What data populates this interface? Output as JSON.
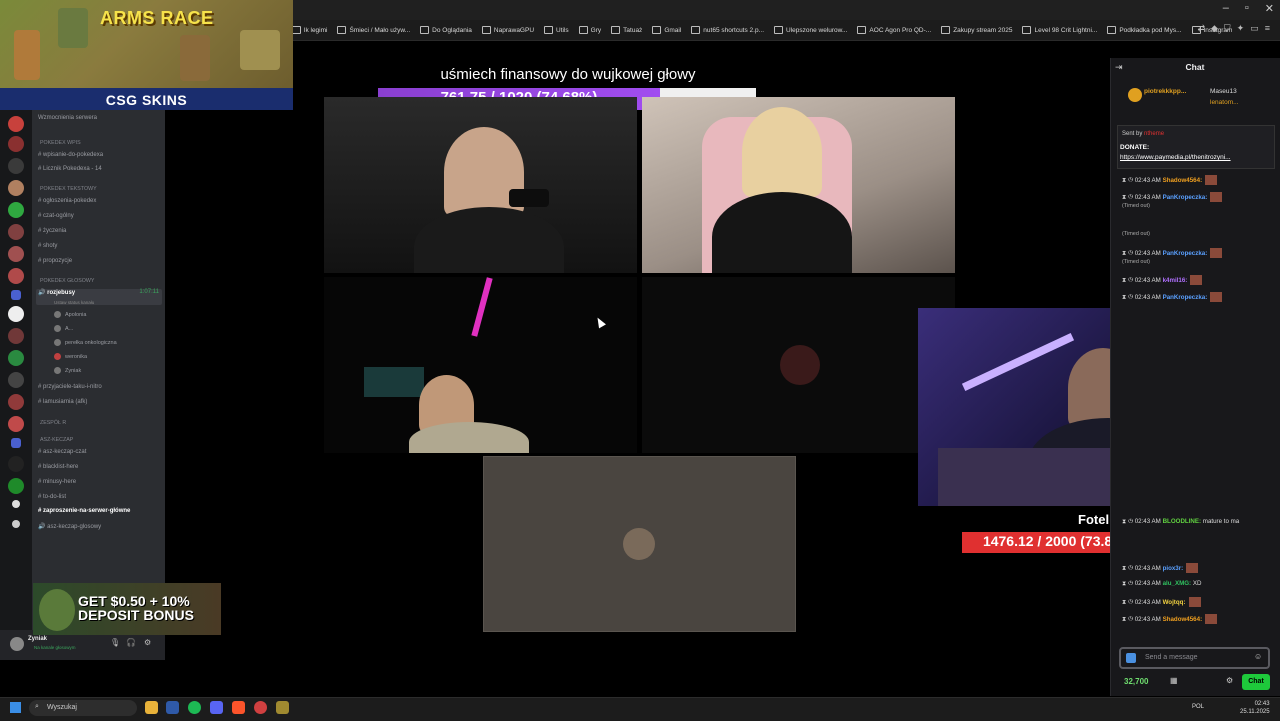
{
  "window": {
    "controls": [
      "–",
      "▫",
      "✕"
    ],
    "bookmarks": [
      "lk legimi",
      "Śmieci / Mało używ...",
      "Do Oglądania",
      "NaprawaGPU",
      "Utils",
      "Gry",
      "Tatuaż",
      "Gmail",
      "nut65 shortcuts 2.p...",
      "Ulepszone welurow...",
      "AOC Agon Pro QD-...",
      "Zakupy stream 2025",
      "Level 98 Crit Lightni...",
      "Podkładka pod Mys...",
      "Instagram"
    ]
  },
  "ads": {
    "top_game_title": "ARMS RACE",
    "top_sponsor": "CSG SKINS",
    "bonus_line1": "GET $0.50 + 10%",
    "bonus_line2": "DEPOSIT BONUS"
  },
  "discord": {
    "top_item": "Wzmocnienia serwera",
    "categories": [
      {
        "name": "POKEDEX Wpis",
        "channels": [
          "wpisanie-do-pokedexa",
          "Licznik Pokedexa - 14"
        ]
      },
      {
        "name": "POKEDEX Tekstowy",
        "channels": [
          "ogłoszenia-pokedex",
          "czat-ogólny",
          "życzenia",
          "shoty",
          "propozycje"
        ]
      },
      {
        "name": "POKEDEX GŁOSOWY",
        "channels": [
          "rozjebusy"
        ]
      }
    ],
    "voice_status": "Ustaw status kanału",
    "voice_timer": "1:07:11",
    "voice_users": [
      "Apolonia",
      "A...",
      "perełka onkologiczna",
      "weronika",
      "Zyniak"
    ],
    "more_channels": [
      "przyjaciele-taku-i-nitro",
      "lamusiarnia (afk)"
    ],
    "category_zespol": "Zespół R",
    "category_asz": "asz-keczap",
    "asz_channels": [
      "asz-keczap-czat",
      "blacklist-here",
      "minusy-here",
      "to-do-list",
      "zaproszenie-na-serwer-główne",
      "asz-keczap-glosowy"
    ],
    "user": {
      "name": "Zyniak",
      "status": "Na kanale głosowym"
    }
  },
  "stream": {
    "goal1_title": "uśmiech finansowy do wujkowej głowy",
    "goal1_text": "761.75 / 1020 (74.68%)",
    "goal1_fraction": 0.7468,
    "goal2_label": "Fotel",
    "goal2_text": "1476.12 / 2000 (73.81%)",
    "goal2_fraction": 0.7381
  },
  "chat": {
    "title": "Chat",
    "top_users": [
      "piotrekkkpp...",
      "Maseu13",
      "lenatom..."
    ],
    "pinned_sent_by": "Sent by",
    "pinned_user": "ntheme",
    "pinned_label": "DONATE:",
    "pinned_link": "https://www.paymedia.pl/thenitrozyni...",
    "messages": [
      {
        "time": "02:43 AM",
        "name": "Shadow4564:",
        "color": "#f0a020",
        "text": ""
      },
      {
        "time": "",
        "name": "",
        "color": "#aaaaaa",
        "text": "(Timed out)"
      },
      {
        "time": "02:43 AM",
        "name": "PanKropeczka:",
        "color": "#5aa0ff",
        "text": ""
      },
      {
        "time": "",
        "name": "",
        "color": "#aaaaaa",
        "text": "(Timed out)"
      },
      {
        "time": "02:43 AM",
        "name": "PanKropeczka:",
        "color": "#5aa0ff",
        "text": ""
      },
      {
        "time": "",
        "name": "",
        "color": "#aaaaaa",
        "text": "(Timed out)"
      },
      {
        "time": "02:43 AM",
        "name": "k4mil16:",
        "color": "#b070ff",
        "text": ""
      },
      {
        "time": "02:43 AM",
        "name": "PanKropeczka:",
        "color": "#5aa0ff",
        "text": ""
      },
      {
        "time": "02:43 AM",
        "name": "BLOODLINE:",
        "color": "#60d040",
        "text": " mature to ma"
      },
      {
        "time": "02:43 AM",
        "name": "piox3r:",
        "color": "#5aa0ff",
        "text": ""
      },
      {
        "time": "02:43 AM",
        "name": "alu_XMG:",
        "color": "#30c060",
        "text": " XD"
      },
      {
        "time": "02:43 AM",
        "name": "Wojtqq:",
        "color": "#f0d040",
        "text": ""
      },
      {
        "time": "02:43 AM",
        "name": "Shadow4564:",
        "color": "#f0a020",
        "text": ""
      }
    ],
    "input_placeholder": "Send a message",
    "points": "32,700",
    "chat_button": "Chat"
  },
  "taskbar": {
    "search_placeholder": "Wyszukaj",
    "lang": "POL",
    "time": "02:43",
    "date": "25.11.2025"
  }
}
